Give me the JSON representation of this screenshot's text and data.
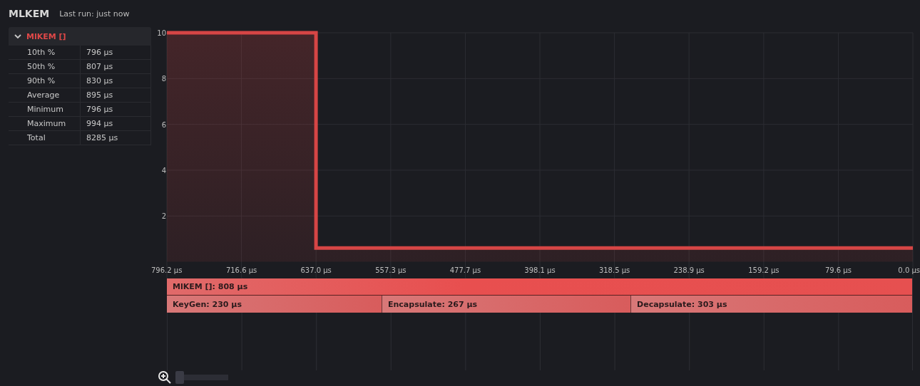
{
  "header": {
    "title": "MLKEM",
    "last_run": "Last run: just now"
  },
  "tree": {
    "label": "MlKEM []",
    "expanded": true,
    "color": "#e04848",
    "stats": [
      {
        "label": "10th %",
        "value": "796 µs"
      },
      {
        "label": "50th %",
        "value": "807 µs"
      },
      {
        "label": "90th %",
        "value": "830 µs"
      },
      {
        "label": "Average",
        "value": "895 µs"
      },
      {
        "label": "Minimum",
        "value": "796 µs"
      },
      {
        "label": "Maximum",
        "value": "994 µs"
      },
      {
        "label": "Total",
        "value": "8285 µs"
      }
    ]
  },
  "chart": {
    "chart_data": {
      "type": "area",
      "xlim": [
        796.2,
        0
      ],
      "ylim": [
        0,
        10
      ],
      "x": [
        796.2,
        637.0,
        637.0,
        0.0
      ],
      "series": [
        {
          "color": "#d64545",
          "values": [
            10,
            10,
            0.6,
            0.6
          ]
        }
      ],
      "xticks": [
        {
          "value": 796.2,
          "label": "796.2 µs"
        },
        {
          "value": 716.6,
          "label": "716.6 µs"
        },
        {
          "value": 637.0,
          "label": "637.0 µs"
        },
        {
          "value": 557.3,
          "label": "557.3 µs"
        },
        {
          "value": 477.7,
          "label": "477.7 µs"
        },
        {
          "value": 398.1,
          "label": "398.1 µs"
        },
        {
          "value": 318.5,
          "label": "318.5 µs"
        },
        {
          "value": 238.9,
          "label": "238.9 µs"
        },
        {
          "value": 159.2,
          "label": "159.2 µs"
        },
        {
          "value": 79.6,
          "label": "79.6 µs"
        },
        {
          "value": 0.0,
          "label": "0.0 µs"
        }
      ],
      "yticks": [
        2,
        4,
        6,
        8,
        10
      ],
      "grid": true
    }
  },
  "flame": {
    "root": "MlKEM []: 808 µs",
    "children": [
      {
        "label": "KeyGen: 230 µs"
      },
      {
        "label": "Encapsulate: 267 µs"
      },
      {
        "label": "Decapsulate: 303 µs"
      }
    ]
  },
  "zoom": {
    "level": 0
  }
}
